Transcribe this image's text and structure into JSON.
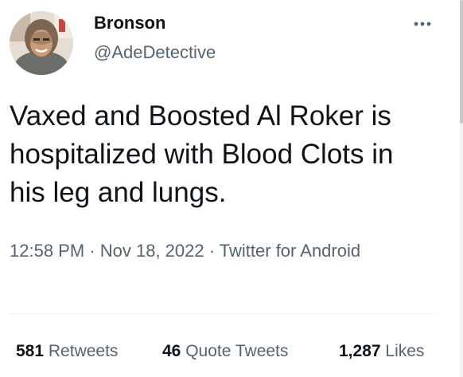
{
  "tweet": {
    "author": {
      "name": "Bronson",
      "handle": "@AdeDetective"
    },
    "more_icon": "more-horizontal-icon",
    "text": "Vaxed and Boosted Al Roker is hospitalized with Blood Clots in his leg and lungs.",
    "time": "12:58 PM",
    "separator_1": "·",
    "date": "Nov 18, 2022",
    "separator_2": "·",
    "source": "Twitter for Android",
    "stats": {
      "retweets_count": "581",
      "retweets_label": "Retweets",
      "quotes_count": "46",
      "quotes_label": "Quote Tweets",
      "likes_count": "1,287",
      "likes_label": "Likes"
    }
  },
  "colors": {
    "primary_text": "#0f1419",
    "secondary_text": "#536471",
    "divider": "#eff3f4"
  }
}
